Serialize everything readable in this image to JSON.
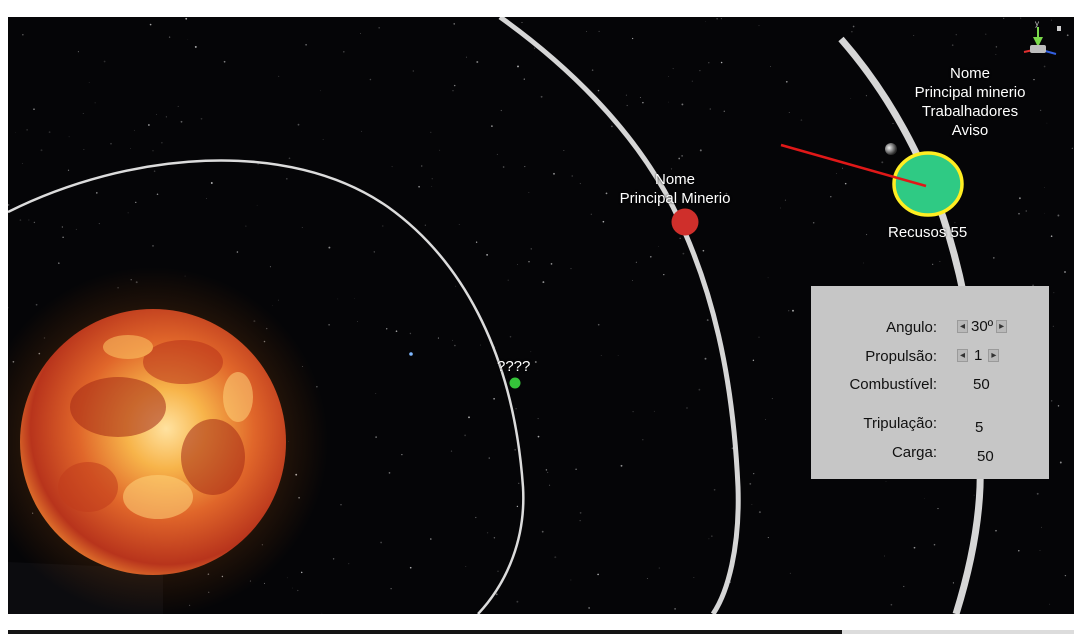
{
  "labels": {
    "unknown_planet": "????",
    "red_planet_name": "Nome",
    "red_planet_mineral": "Principal Minerio",
    "selected_planet_name": "Nome",
    "selected_planet_mineral": "Principal minerio",
    "selected_planet_workers": "Trabalhadores",
    "selected_planet_warning": "Aviso",
    "selected_planet_resources": "Recusos 55"
  },
  "panel": {
    "angle_label": "Angulo:",
    "angle_value": "30º",
    "propulsion_label": "Propulsão:",
    "propulsion_value": "1",
    "fuel_label": "Combustível:",
    "fuel_value": "50",
    "crew_label": "Tripulação:",
    "crew_value": "5",
    "cargo_label": "Carga:",
    "cargo_value": "50",
    "decrement_symbol": "◂",
    "increment_symbol": "▸"
  },
  "gizmo": {
    "axis_label": "y"
  },
  "colors": {
    "space": "#050507",
    "orbit": "#d8d8d8",
    "sun_core": "#f3a233",
    "sun_dark": "#b0321a",
    "red_planet": "#cf2f2b",
    "green_planet": "#2fca84",
    "selection_ring": "#ffee22",
    "small_planet": "#35c43a",
    "aim_line": "#e01818",
    "panel_bg": "#c6c6c6"
  }
}
